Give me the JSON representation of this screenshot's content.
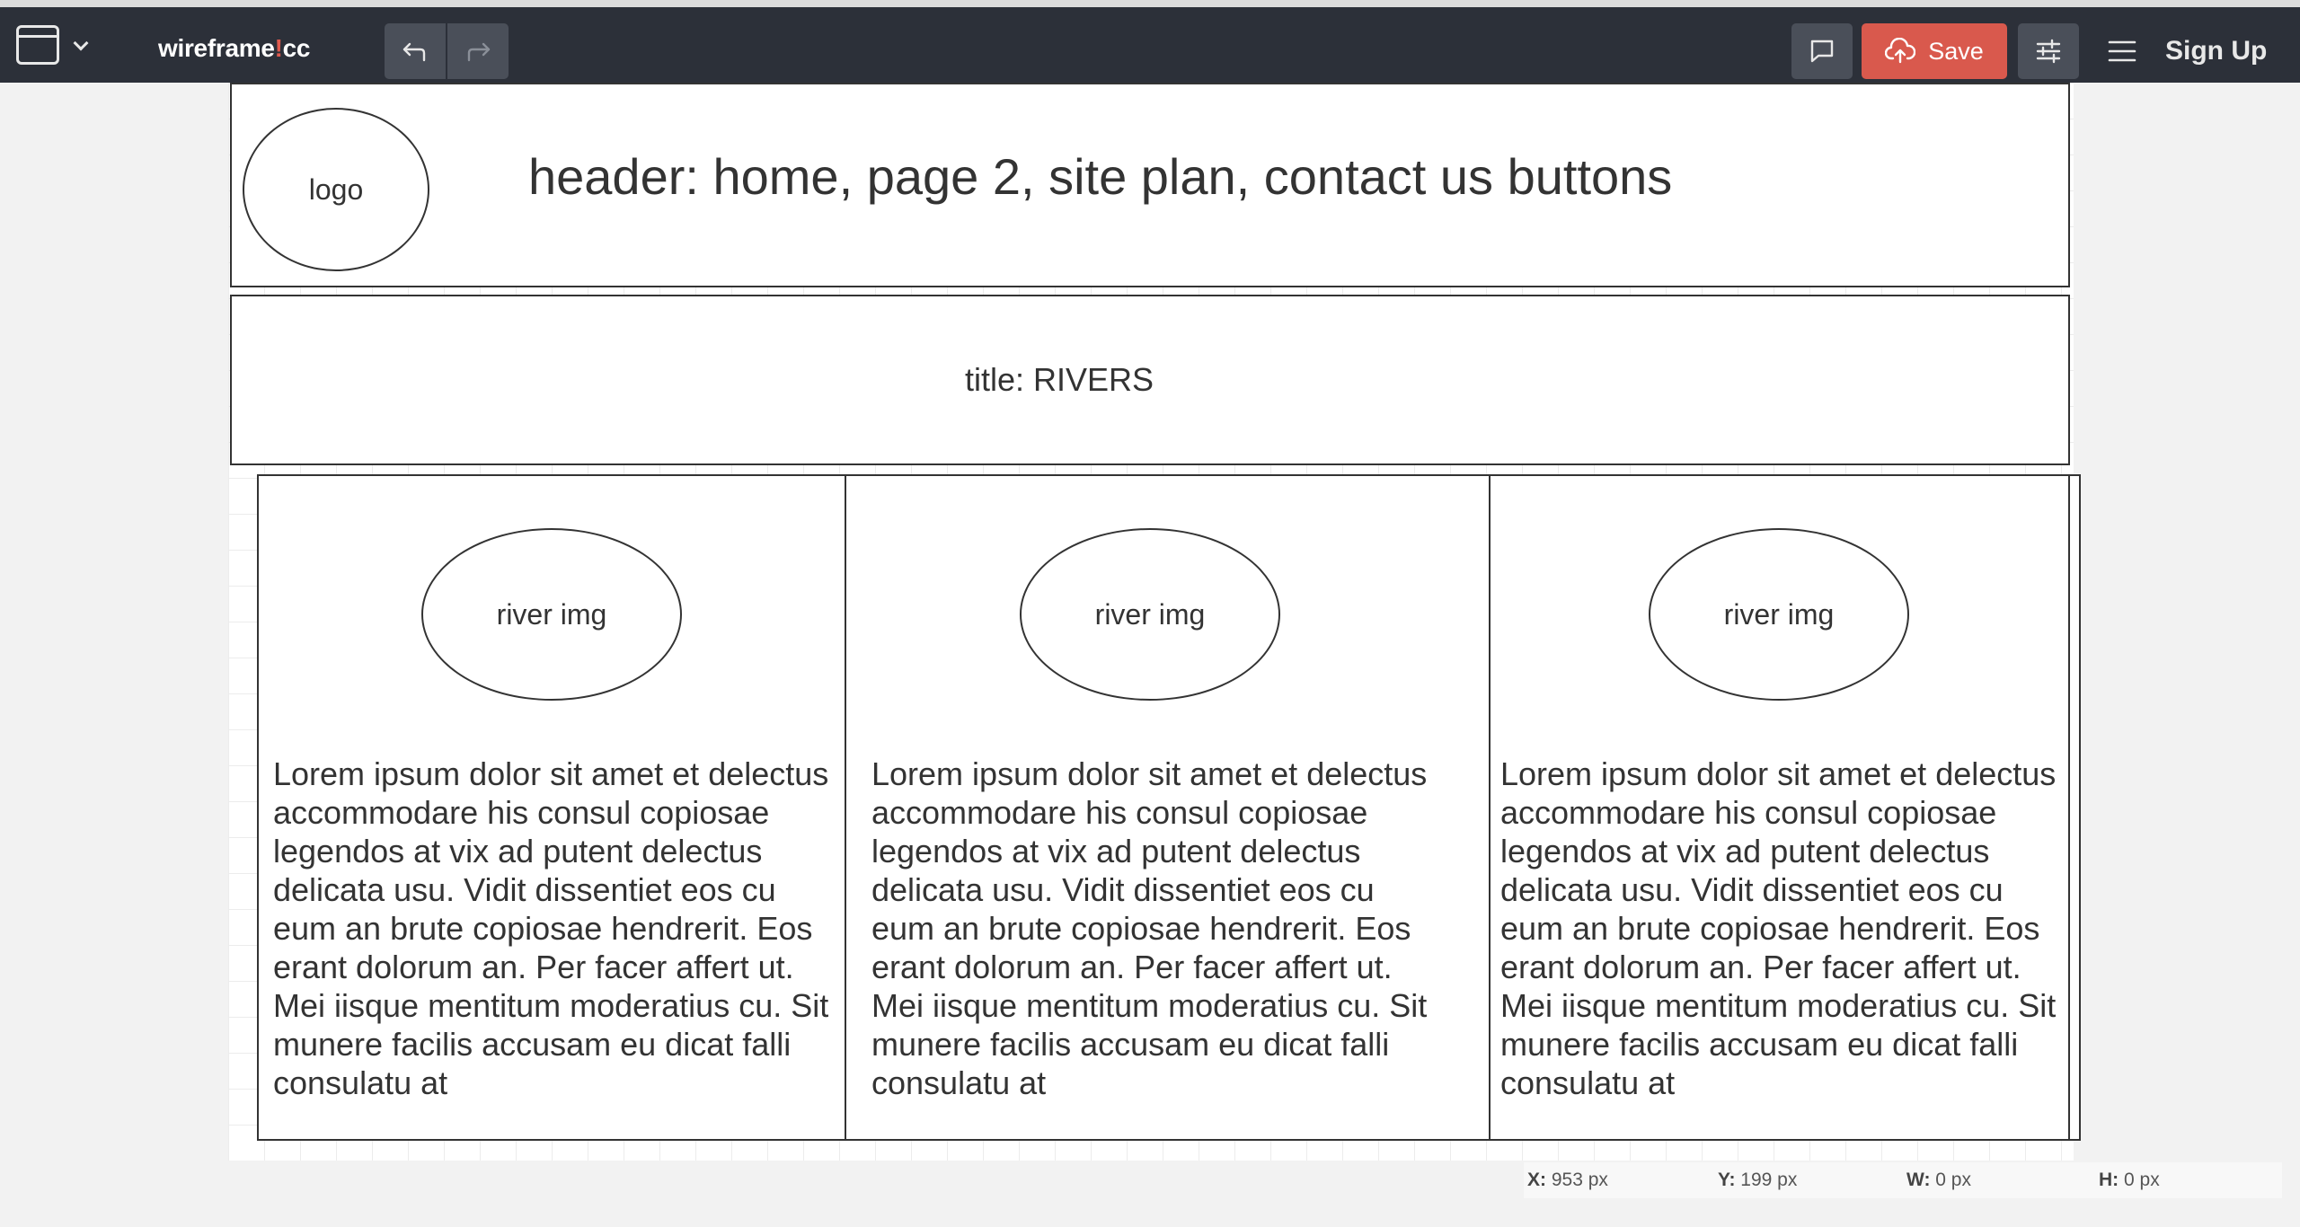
{
  "app": {
    "brand_prefix": "wireframe",
    "brand_bang": "!",
    "brand_suffix": "cc"
  },
  "toolbar": {
    "save_label": "Save",
    "signup_label": "Sign Up"
  },
  "wireframe": {
    "logo_label": "logo",
    "header_text": "header: home, page 2, site plan, contact us buttons",
    "title_text": "title: RIVERS",
    "columns": [
      {
        "image_label": "river img",
        "text": "Lorem ipsum dolor sit amet et delectus accommodare his consul copiosae legendos at vix ad putent delectus delicata usu. Vidit dissentiet eos cu eum an brute copiosae hendrerit. Eos erant dolorum an. Per facer affert ut. Mei iisque mentitum moderatius cu. Sit munere facilis accusam eu dicat falli consulatu at"
      },
      {
        "image_label": "river img",
        "text": "Lorem ipsum dolor sit amet et delectus accommodare his consul copiosae legendos at vix ad putent delectus delicata usu. Vidit dissentiet eos cu eum an brute copiosae hendrerit. Eos erant dolorum an. Per facer affert ut. Mei iisque mentitum moderatius cu. Sit munere facilis accusam eu dicat falli consulatu at"
      },
      {
        "image_label": "river img",
        "text": "Lorem ipsum dolor sit amet et delectus accommodare his consul copiosae legendos at vix ad putent delectus delicata usu. Vidit dissentiet eos cu eum an brute copiosae hendrerit. Eos erant dolorum an. Per facer affert ut. Mei iisque mentitum moderatius cu. Sit munere facilis accusam eu dicat falli consulatu at"
      }
    ]
  },
  "statusbar": {
    "x_label": "X:",
    "x_value": "953 px",
    "y_label": "Y:",
    "y_value": "199 px",
    "w_label": "W:",
    "w_value": "0 px",
    "h_label": "H:",
    "h_value": "0 px"
  },
  "icons": {
    "window": "window-icon",
    "dropdown": "chevron-down-icon",
    "undo": "undo-icon",
    "redo": "redo-icon",
    "comment": "comment-icon",
    "save": "cloud-upload-icon",
    "settings": "sliders-icon",
    "menu": "hamburger-menu-icon"
  },
  "colors": {
    "topbar": "#2c3039",
    "button": "#4a4f59",
    "save": "#d9594d",
    "brand_bang": "#e05a4e"
  }
}
